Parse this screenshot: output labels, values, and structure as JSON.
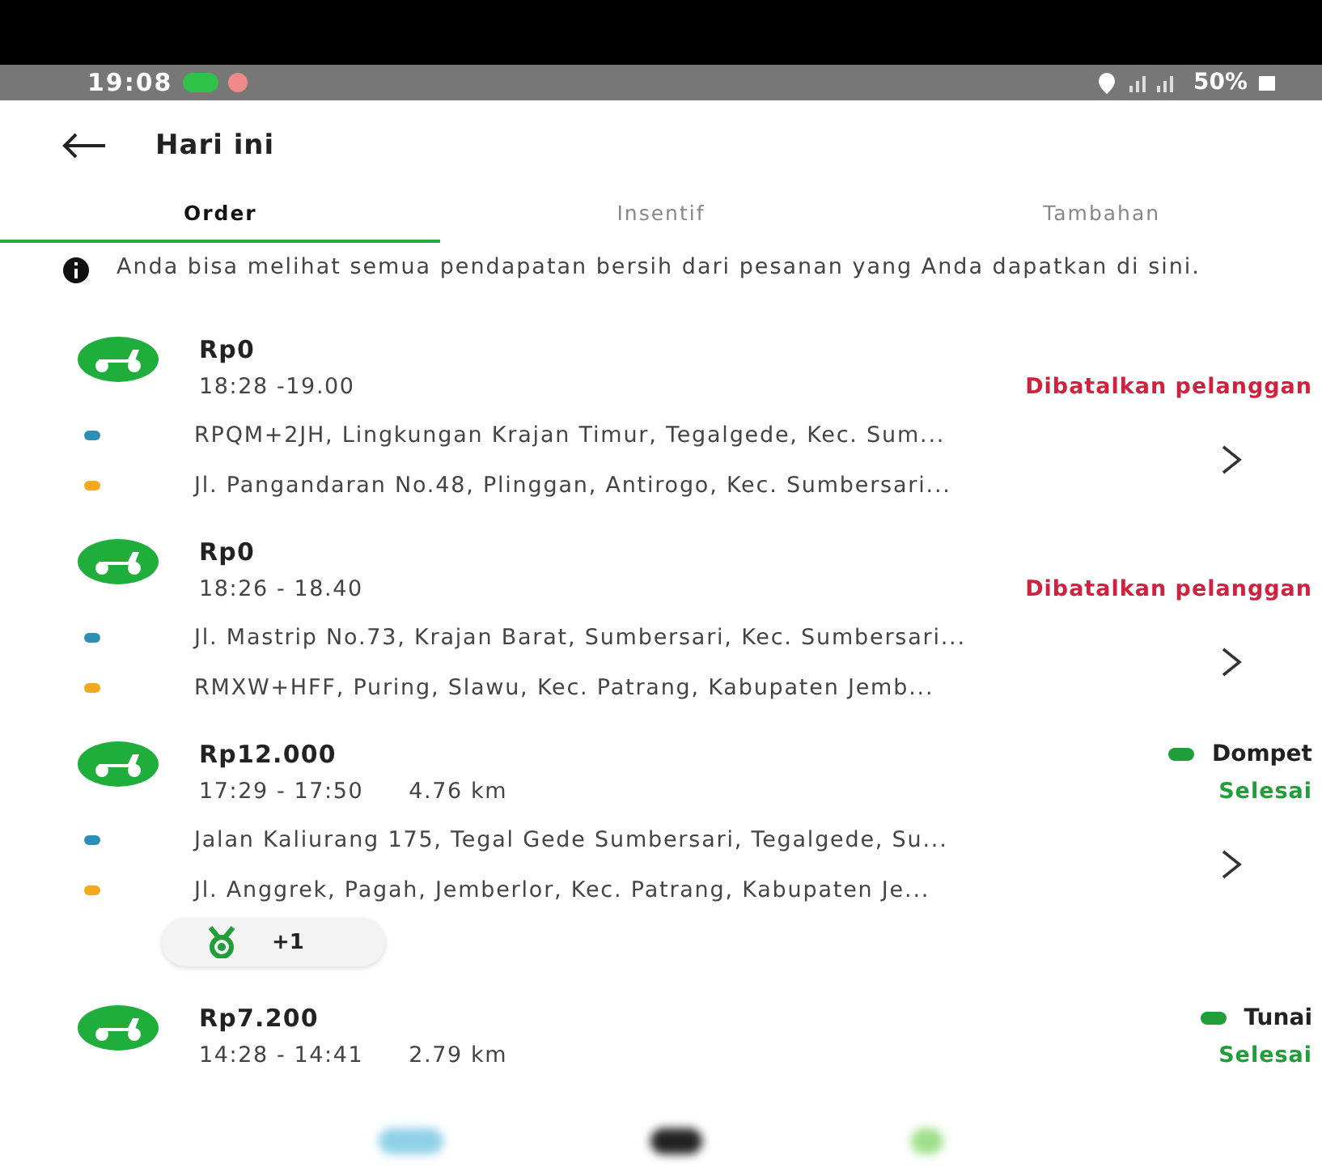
{
  "status_bar": {
    "time": "19:08",
    "battery": "50%"
  },
  "header": {
    "title": "Hari ini"
  },
  "tabs": [
    {
      "label": "Order",
      "selected": true
    },
    {
      "label": "Insentif",
      "selected": false
    },
    {
      "label": "Tambahan",
      "selected": false
    }
  ],
  "info": "Anda bisa melihat semua pendapatan bersih dari pesanan yang Anda dapatkan di sini.",
  "orders": [
    {
      "amount": "Rp0",
      "time": "18:28 -19.00",
      "status": "Dibatalkan pelanggan",
      "kind": "cancelled",
      "pickup": "RPQM+2JH, Lingkungan Krajan Timur, Tegalgede, Kec. Sum...",
      "dropoff": "Jl. Pangandaran No.48, Plinggan, Antirogo, Kec. Sumbersari..."
    },
    {
      "amount": "Rp0",
      "time": "18:26 - 18.40",
      "status": "Dibatalkan pelanggan",
      "kind": "cancelled",
      "pickup": "Jl. Mastrip No.73, Krajan Barat, Sumbersari, Kec. Sumbersari...",
      "dropoff": "RMXW+HFF, Puring, Slawu, Kec. Patrang, Kabupaten Jemb..."
    },
    {
      "amount": "Rp12.000",
      "time": "17:29 - 17:50",
      "distance": "4.76 km",
      "payment": "Dompet",
      "status": "Selesai",
      "kind": "completed",
      "pickup": "Jalan Kaliurang 175, Tegal Gede Sumbersari, Tegalgede, Su...",
      "dropoff": "Jl. Anggrek, Pagah, Jemberlor, Kec. Patrang, Kabupaten Je...",
      "badge": "+1"
    },
    {
      "amount": "Rp7.200",
      "time": "14:28 - 14:41",
      "distance": "2.79 km",
      "payment": "Tunai",
      "status": "Selesai",
      "kind": "completed"
    }
  ]
}
